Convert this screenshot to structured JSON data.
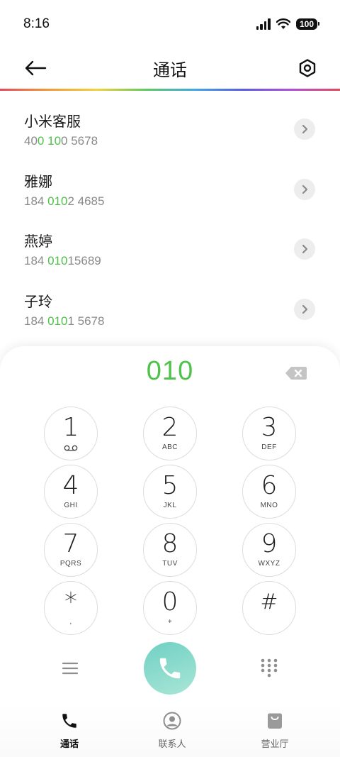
{
  "status": {
    "time": "8:16",
    "battery": "100"
  },
  "header": {
    "title": "通话"
  },
  "contacts": [
    {
      "name": "小米客服",
      "number_parts": [
        "40",
        "0",
        " ",
        "10",
        "0 5678"
      ]
    },
    {
      "name": "雅娜",
      "number_parts": [
        "184 ",
        "010",
        "2 4685"
      ]
    },
    {
      "name": "燕婷",
      "number_parts": [
        "184 ",
        "010",
        "15689"
      ]
    },
    {
      "name": "子玲",
      "number_parts": [
        "184 ",
        "010",
        "1 5678"
      ]
    }
  ],
  "dialpad": {
    "display": "010",
    "keys": [
      {
        "digit": "1",
        "letters": ""
      },
      {
        "digit": "2",
        "letters": "ABC"
      },
      {
        "digit": "3",
        "letters": "DEF"
      },
      {
        "digit": "4",
        "letters": "GHI"
      },
      {
        "digit": "5",
        "letters": "JKL"
      },
      {
        "digit": "6",
        "letters": "MNO"
      },
      {
        "digit": "7",
        "letters": "PQRS"
      },
      {
        "digit": "8",
        "letters": "TUV"
      },
      {
        "digit": "9",
        "letters": "WXYZ"
      },
      {
        "digit": "*",
        "letters": ","
      },
      {
        "digit": "0",
        "letters": "+"
      },
      {
        "digit": "#",
        "letters": ""
      }
    ]
  },
  "bottom_nav": {
    "calls": "通话",
    "contacts": "联系人",
    "store": "营业厅"
  },
  "colors": {
    "accent_green": "#4fc24a",
    "call_button": "#8ddccf",
    "highlight": "#4fbf4a"
  },
  "icons": [
    "back-arrow-icon",
    "settings-icon",
    "chevron-right-icon",
    "voicemail-icon",
    "backspace-icon",
    "menu-icon",
    "phone-icon",
    "keypad-grid-icon",
    "contact-person-icon",
    "store-bag-icon"
  ]
}
